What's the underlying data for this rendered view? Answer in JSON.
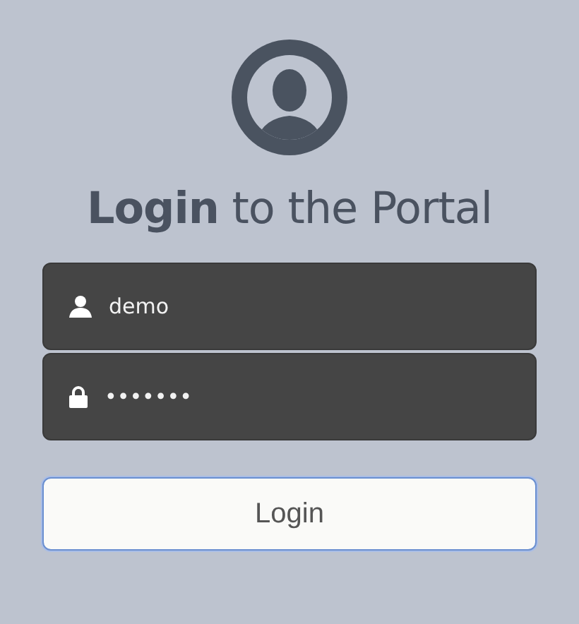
{
  "title": "**Login** to the Portal",
  "fields": [
    {
      "kind": "user",
      "value": "demo"
    },
    {
      "kind": "password",
      "value": "•••••••"
    }
  ],
  "button": {
    "label": "Login"
  }
}
